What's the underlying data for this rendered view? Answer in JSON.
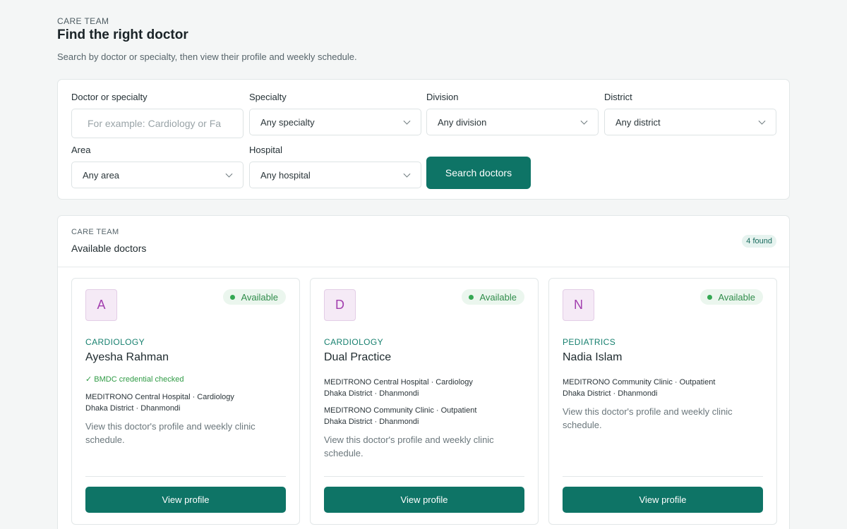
{
  "header": {
    "eyebrow": "CARE TEAM",
    "title": "Find the right doctor",
    "subtitle": "Search by doctor or specialty, then view their profile and weekly schedule."
  },
  "search": {
    "query_label": "Doctor or specialty",
    "query_placeholder": "For example: Cardiology or Fa",
    "specialty_label": "Specialty",
    "specialty_value": "Any specialty",
    "division_label": "Division",
    "division_value": "Any division",
    "district_label": "District",
    "district_value": "Any district",
    "area_label": "Area",
    "area_value": "Any area",
    "hospital_label": "Hospital",
    "hospital_value": "Any hospital",
    "submit_label": "Search doctors"
  },
  "results": {
    "eyebrow": "CARE TEAM",
    "title": "Available doctors",
    "count": "4 found",
    "doctors": [
      {
        "initial": "A",
        "status": "Available",
        "specialty": "CARDIOLOGY",
        "name": "Ayesha Rahman",
        "credential": "✓ BMDC credential checked",
        "locations": [
          {
            "line1": "MEDITRONO Central Hospital · Cardiology",
            "line2": "Dhaka District · Dhanmondi"
          }
        ],
        "description": "View this doctor's profile and weekly clinic schedule.",
        "button": "View profile"
      },
      {
        "initial": "D",
        "status": "Available",
        "specialty": "CARDIOLOGY",
        "name": "Dual Practice",
        "locations": [
          {
            "line1": "MEDITRONO Central Hospital · Cardiology",
            "line2": "Dhaka District · Dhanmondi"
          },
          {
            "line1": "MEDITRONO Community Clinic · Outpatient",
            "line2": "Dhaka District · Dhanmondi"
          }
        ],
        "description": "View this doctor's profile and weekly clinic schedule.",
        "button": "View profile"
      },
      {
        "initial": "N",
        "status": "Available",
        "specialty": "PEDIATRICS",
        "name": "Nadia Islam",
        "locations": [
          {
            "line1": "MEDITRONO Community Clinic · Outpatient",
            "line2": "Dhaka District · Dhanmondi"
          }
        ],
        "description": "View this doctor's profile and weekly clinic schedule.",
        "button": "View profile"
      }
    ]
  },
  "colors": {
    "primary": "#0e7466",
    "accent_specialty": "#17806f",
    "available_green": "#34a853",
    "avatar_purple": "#a23eae"
  },
  "icons": {
    "select_arrow": "chevron-down-icon",
    "status_indicator": "status-dot-icon",
    "credential_mark": "check-icon"
  }
}
